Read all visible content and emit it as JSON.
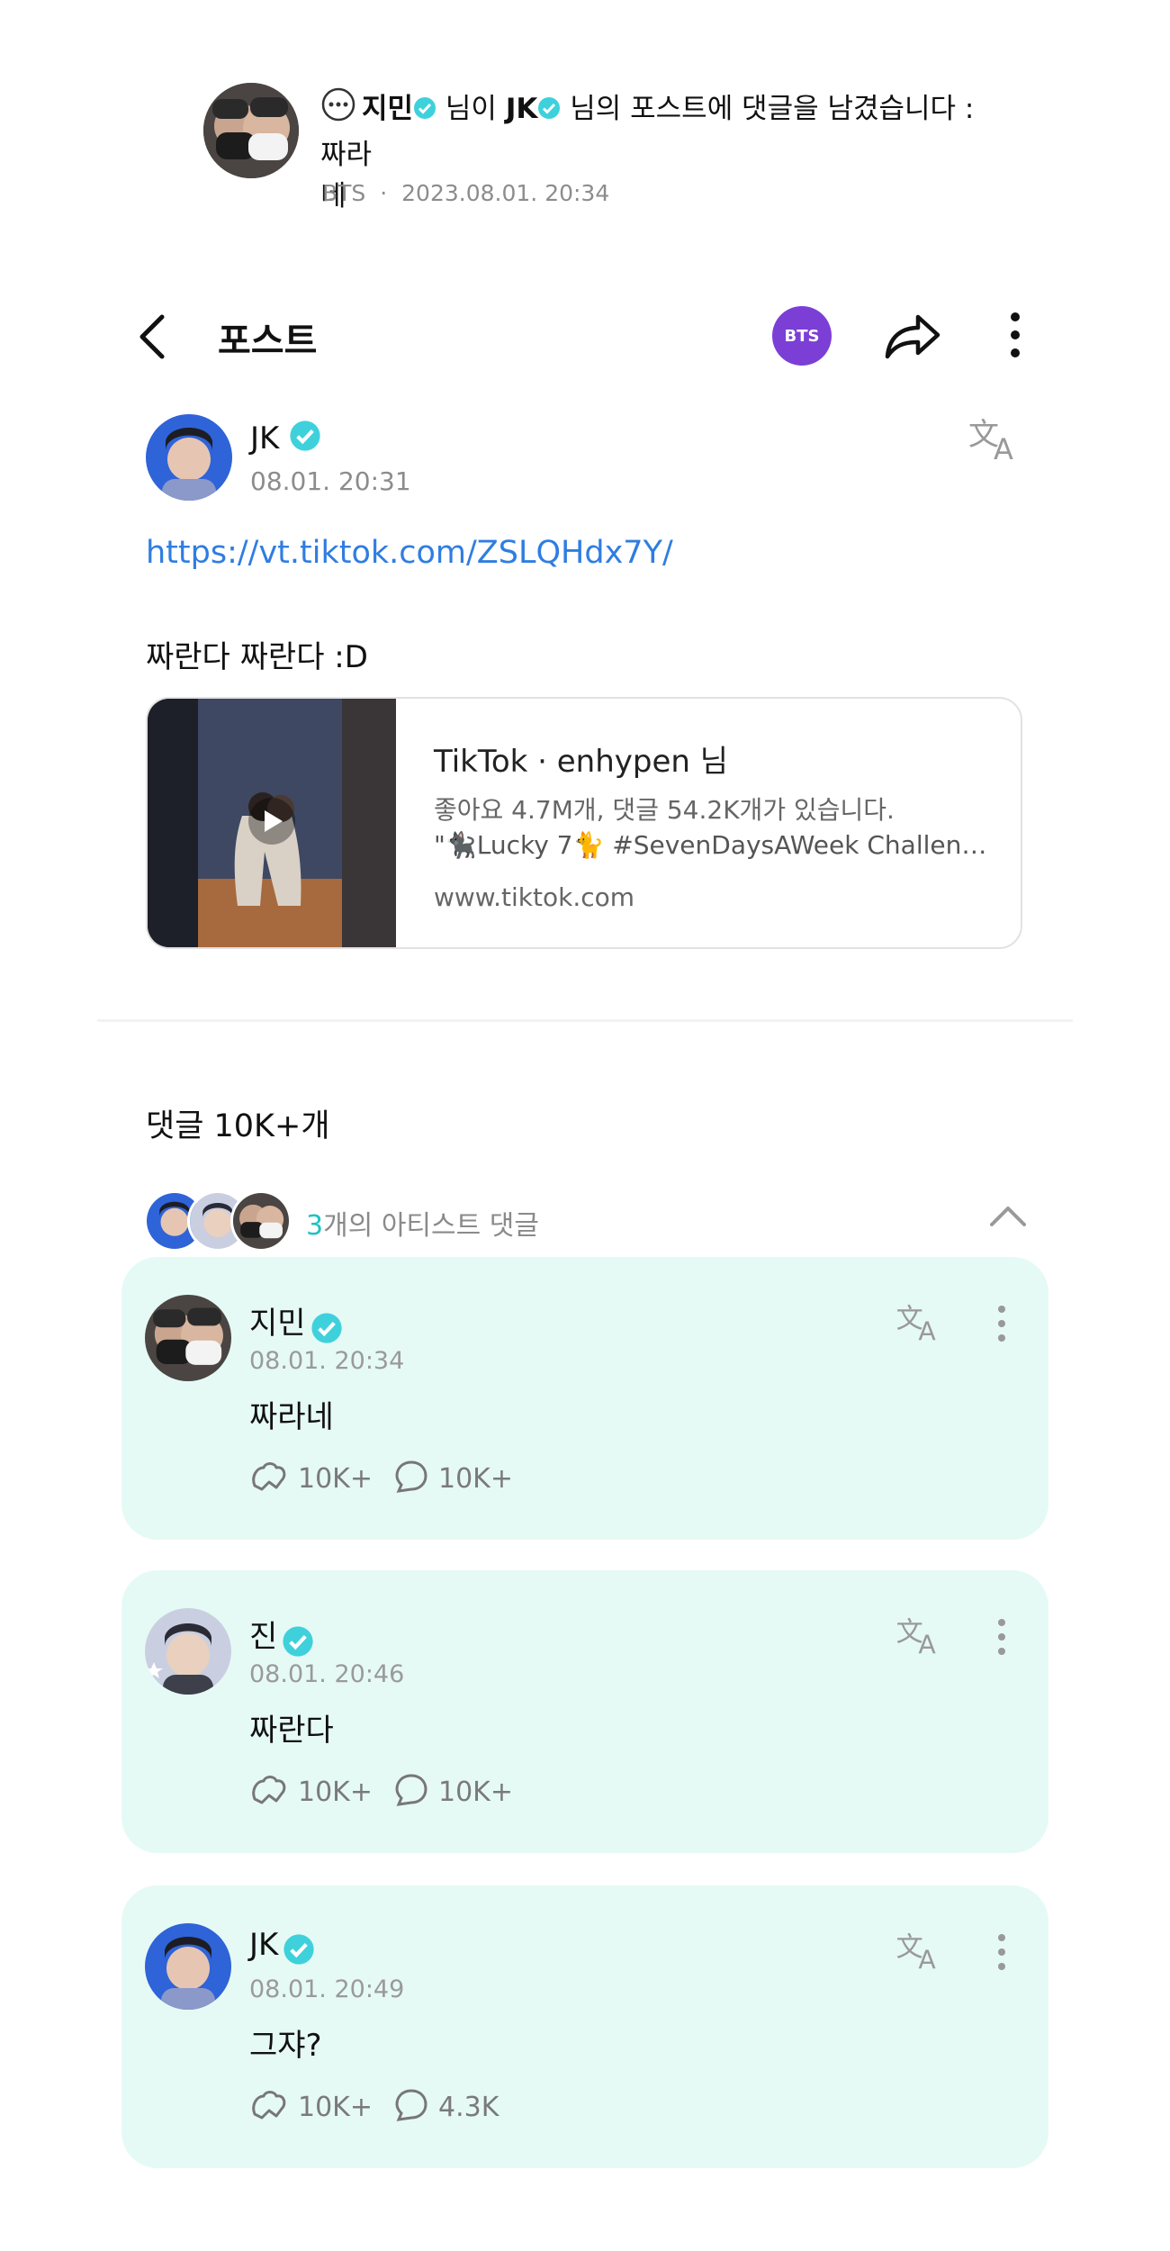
{
  "notification": {
    "icon": "comment-bubble-icon",
    "actor": "지민",
    "text_mid": "님이",
    "target": "JK",
    "text_end": "님의 포스트에 댓글을 남겼습니다 : 짜라",
    "text_wrap": "네",
    "group": "BTS",
    "timestamp": "2023.08.01. 20:34"
  },
  "header": {
    "title": "포스트",
    "badge": "BTS",
    "badge_color": "#7b3fd6",
    "back_icon": "back-arrow-icon",
    "share_icon": "share-icon",
    "more_icon": "more-vertical-icon"
  },
  "post": {
    "author": "JK",
    "time": "08.01. 20:31",
    "link": "https://vt.tiktok.com/ZSLQHdx7Y/",
    "body": "짜란다 짜란다 :D",
    "translate_icon": "translate-icon"
  },
  "preview": {
    "title": "TikTok · enhypen 님",
    "stats": "좋아요 4.7M개, 댓글 54.2K개가 있습니다.",
    "description": "\"🐈‍⬛Lucky 7🐈 #SevenDaysAWeek Challen…",
    "domain": "www.tiktok.com"
  },
  "comments_section": {
    "count_label": "댓글 10K+개",
    "artist_count": "3",
    "artist_label": "개의 아티스트 댓글",
    "accent_color": "#22c1c3"
  },
  "comments": [
    {
      "name": "지민",
      "time": "08.01. 20:34",
      "body": "짜라네",
      "likes": "10K+",
      "replies": "10K+"
    },
    {
      "name": "진",
      "time": "08.01. 20:46",
      "body": "짜란다",
      "likes": "10K+",
      "replies": "10K+"
    },
    {
      "name": "JK",
      "time": "08.01. 20:49",
      "body": "그쟈?",
      "likes": "10K+",
      "replies": "4.3K"
    }
  ]
}
